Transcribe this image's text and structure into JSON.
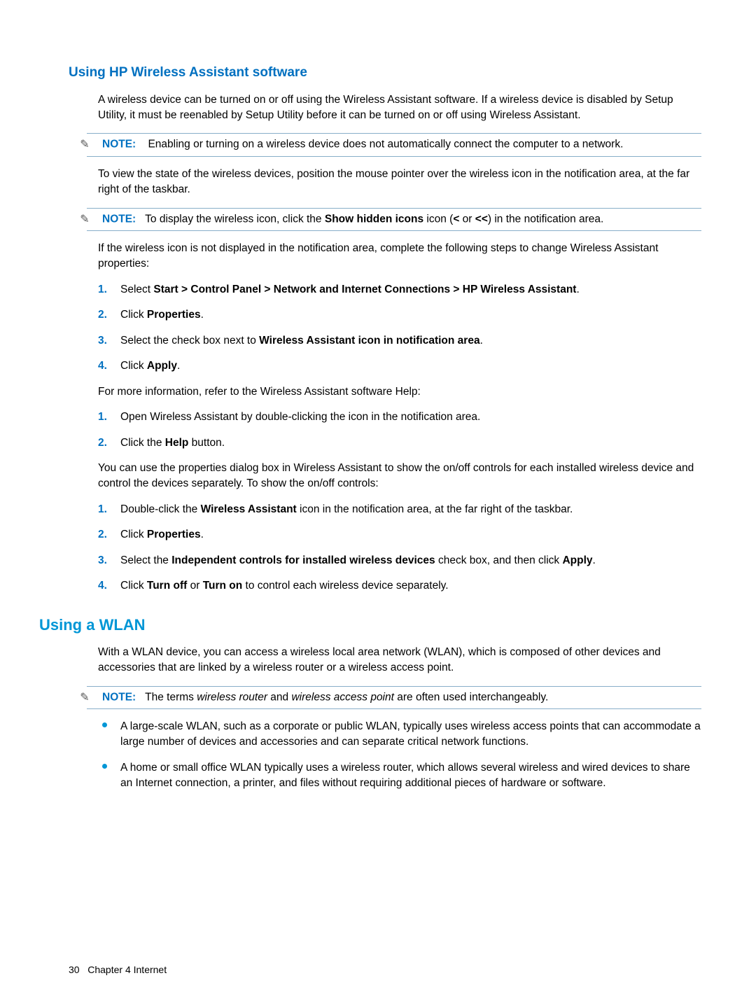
{
  "sec1": {
    "heading": "Using HP Wireless Assistant software",
    "p1": "A wireless device can be turned on or off using the Wireless Assistant software. If a wireless device is disabled by Setup Utility, it must be reenabled by Setup Utility before it can be turned on or off using Wireless Assistant.",
    "note1": {
      "label": "NOTE:",
      "text": "Enabling or turning on a wireless device does not automatically connect the computer to a network."
    },
    "p2": "To view the state of the wireless devices, position the mouse pointer over the wireless icon in the notification area, at the far right of the taskbar.",
    "note2": {
      "label": "NOTE:",
      "pre": "To display the wireless icon, click the ",
      "bold": "Show hidden icons",
      "mid": " icon (",
      "b1": "<",
      "or": " or ",
      "b2": "<<",
      "post": ") in the notification area."
    },
    "p3": "If the wireless icon is not displayed in the notification area, complete the following steps to change Wireless Assistant properties:",
    "list1": {
      "i1": {
        "n": "1.",
        "pre": "Select ",
        "bold": "Start > Control Panel > Network and Internet Connections > HP Wireless Assistant",
        "post": "."
      },
      "i2": {
        "n": "2.",
        "pre": "Click ",
        "bold": "Properties",
        "post": "."
      },
      "i3": {
        "n": "3.",
        "pre": "Select the check box next to ",
        "bold": "Wireless Assistant icon in notification area",
        "post": "."
      },
      "i4": {
        "n": "4.",
        "pre": "Click ",
        "bold": "Apply",
        "post": "."
      }
    },
    "p4": "For more information, refer to the Wireless Assistant software Help:",
    "list2": {
      "i1": {
        "n": "1.",
        "text": "Open Wireless Assistant by double-clicking the icon in the notification area."
      },
      "i2": {
        "n": "2.",
        "pre": "Click the ",
        "bold": "Help",
        "post": " button."
      }
    },
    "p5": "You can use the properties dialog box in Wireless Assistant to show the on/off controls for each installed wireless device and control the devices separately. To show the on/off controls:",
    "list3": {
      "i1": {
        "n": "1.",
        "pre": "Double-click the ",
        "bold": "Wireless Assistant",
        "post": " icon in the notification area, at the far right of the taskbar."
      },
      "i2": {
        "n": "2.",
        "pre": "Click ",
        "bold": "Properties",
        "post": "."
      },
      "i3": {
        "n": "3.",
        "pre": "Select the ",
        "bold": "Independent controls for installed wireless devices",
        "post": " check box, and then click ",
        "bold2": "Apply",
        "post2": "."
      },
      "i4": {
        "n": "4.",
        "pre": "Click ",
        "bold": "Turn off",
        "mid": " or ",
        "bold2": "Turn on",
        "post": " to control each wireless device separately."
      }
    }
  },
  "sec2": {
    "heading": "Using a WLAN",
    "p1": "With a WLAN device, you can access a wireless local area network (WLAN), which is composed of other devices and accessories that are linked by a wireless router or a wireless access point.",
    "note": {
      "label": "NOTE:",
      "pre": "The terms ",
      "i1": "wireless router",
      "mid": " and ",
      "i2": "wireless access point",
      "post": " are often used interchangeably."
    },
    "bullets": {
      "b1": "A large-scale WLAN, such as a corporate or public WLAN, typically uses wireless access points that can accommodate a large number of devices and accessories and can separate critical network functions.",
      "b2": "A home or small office WLAN typically uses a wireless router, which allows several wireless and wired devices to share an Internet connection, a printer, and files without requiring additional pieces of hardware or software."
    }
  },
  "footer": {
    "page": "30",
    "chapter": "Chapter 4   Internet"
  }
}
